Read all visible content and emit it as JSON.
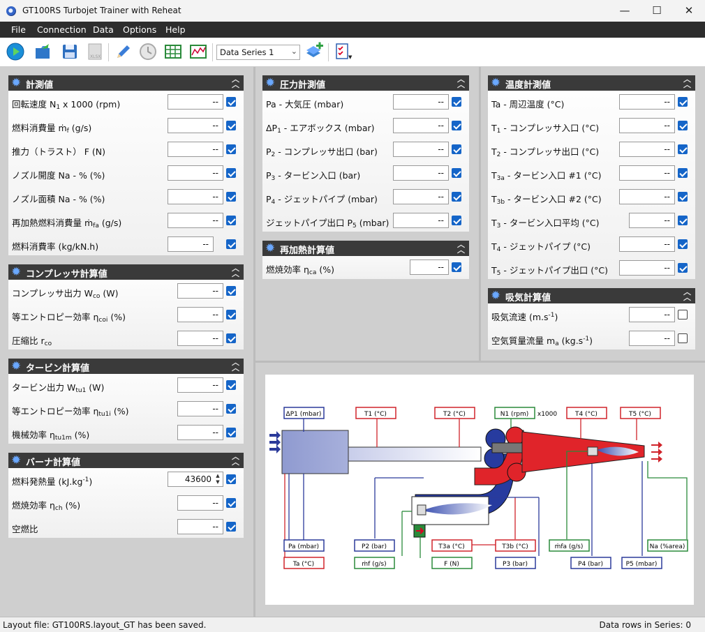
{
  "window": {
    "title": "GT100RS Turbojet Trainer with Reheat",
    "minimize": "—",
    "maximize": "☐",
    "close": "✕"
  },
  "menu": [
    "File",
    "Connection",
    "Data",
    "Options",
    "Help"
  ],
  "toolbar": {
    "series_select": "Data Series 1",
    "icons": [
      "run-icon",
      "open-folder-icon",
      "save-icon",
      "export-xlsx-icon",
      "pencil-icon",
      "clock-icon",
      "table-icon",
      "chart-icon",
      "add-series-icon",
      "checklist-icon"
    ]
  },
  "panels": {
    "measured": {
      "title": "計測値",
      "rows": [
        {
          "label": "回転速度 N",
          "sub": "1",
          "tail": " x 1000  (rpm)",
          "value": "--",
          "checked": true
        },
        {
          "label": "燃料消費量 ṁ",
          "sub": "f",
          "tail": "  (g/s)",
          "value": "--",
          "checked": true
        },
        {
          "label": "推力（トラスト） F  (N)",
          "sub": "",
          "tail": "",
          "value": "--",
          "checked": true
        },
        {
          "label": "ノズル開度 Na - %  (%)",
          "sub": "",
          "tail": "",
          "value": "--",
          "checked": true
        },
        {
          "label": "ノズル面積 Na - %  (%)",
          "sub": "",
          "tail": "",
          "value": "--",
          "checked": true
        },
        {
          "label": "再加熱燃料消費量 ṁ",
          "sub": "fa",
          "tail": "  (g/s)",
          "value": "--",
          "checked": true
        },
        {
          "label": "燃料消費率  (kg/kN.h)",
          "sub": "",
          "tail": "",
          "value": "--",
          "checked": true
        }
      ]
    },
    "compressor": {
      "title": "コンプレッサ計算値",
      "rows": [
        {
          "label": "コンプレッサ出力 W",
          "sub": "co",
          "tail": "  (W)",
          "value": "--",
          "checked": true
        },
        {
          "label": "等エントロピー効率 η",
          "sub": "coi",
          "tail": "  (%)",
          "value": "--",
          "checked": true
        },
        {
          "label": "圧縮比 r",
          "sub": "co",
          "tail": "",
          "value": "--",
          "checked": true
        }
      ]
    },
    "turbine": {
      "title": "タービン計算値",
      "rows": [
        {
          "label": "タービン出力 W",
          "sub": "tu1",
          "tail": "  (W)",
          "value": "--",
          "checked": true
        },
        {
          "label": "等エントロピー効率 η",
          "sub": "tu1i",
          "tail": "  (%)",
          "value": "--",
          "checked": true
        },
        {
          "label": "機械効率 η",
          "sub": "tu1m",
          "tail": "  (%)",
          "value": "--",
          "checked": true
        }
      ]
    },
    "burner": {
      "title": "バーナ計算値",
      "rows": [
        {
          "label": "燃料発熱量  (kJ.kg",
          "sub": "",
          "tail": "",
          "sup": "-1",
          "tail2": ")",
          "value": "43600",
          "checked": true,
          "spin": true
        },
        {
          "label": "燃焼効率 η",
          "sub": "ch",
          "tail": "  (%)",
          "value": "--",
          "checked": true
        },
        {
          "label": "空燃比",
          "sub": "",
          "tail": "",
          "value": "--",
          "checked": true
        }
      ]
    },
    "pressure": {
      "title": "圧力計測値",
      "rows": [
        {
          "label": "Pa - 大気圧  (mbar)",
          "sub": "",
          "tail": "",
          "value": "--",
          "checked": true
        },
        {
          "label": "ΔP",
          "sub": "1",
          "tail": " - エアボックス  (mbar)",
          "value": "--",
          "checked": true
        },
        {
          "label": "P",
          "sub": "2",
          "tail": " - コンプレッサ出口  (bar)",
          "value": "--",
          "checked": true
        },
        {
          "label": "P",
          "sub": "3",
          "tail": " - タービン入口  (bar)",
          "value": "--",
          "checked": true
        },
        {
          "label": "P",
          "sub": "4",
          "tail": " - ジェットパイプ  (mbar)",
          "value": "--",
          "checked": true
        },
        {
          "label": "ジェットパイプ出口 P",
          "sub": "5",
          "tail": "  (mbar)",
          "value": "--",
          "checked": true
        }
      ]
    },
    "reheat": {
      "title": "再加熱計算値",
      "rows": [
        {
          "label": "燃焼効率 η",
          "sub": "ca",
          "tail": "  (%)",
          "value": "--",
          "checked": true
        }
      ]
    },
    "temperature": {
      "title": "温度計測値",
      "rows": [
        {
          "label": "Ta - 周辺温度  (°C)",
          "sub": "",
          "tail": "",
          "value": "--",
          "checked": true
        },
        {
          "label": "T",
          "sub": "1",
          "tail": " - コンプレッサ入口  (°C)",
          "value": "--",
          "checked": true
        },
        {
          "label": "T",
          "sub": "2",
          "tail": " - コンプレッサ出口  (°C)",
          "value": "--",
          "checked": true
        },
        {
          "label": "T",
          "sub": "3a",
          "tail": " - タービン入口 #1  (°C)",
          "value": "--",
          "checked": true
        },
        {
          "label": "T",
          "sub": "3b",
          "tail": " - タービン入口 #2  (°C)",
          "value": "--",
          "checked": true
        },
        {
          "label": "T",
          "sub": "3",
          "tail": " - タービン入口平均  (°C)",
          "value": "--",
          "checked": true
        },
        {
          "label": "T",
          "sub": "4",
          "tail": " - ジェットパイプ  (°C)",
          "value": "--",
          "checked": true
        },
        {
          "label": "T",
          "sub": "5",
          "tail": " - ジェットパイプ出口  (°C)",
          "value": "--",
          "checked": true
        }
      ]
    },
    "intake": {
      "title": "吸気計算値",
      "rows": [
        {
          "label": "吸気流速  (m.s",
          "sub": "",
          "tail": "",
          "sup": "-1",
          "tail2": ")",
          "value": "--",
          "checked": false
        },
        {
          "label": "空気質量流量 m",
          "sub": "a",
          "tail": "  (kg.s",
          "sup": "-1",
          "tail2": ")",
          "value": "--",
          "checked": false
        }
      ]
    }
  },
  "diagram": {
    "labels": {
      "dp1": "ΔP1 (mbar)",
      "t1": "T1 (°C)",
      "t2": "T2 (°C)",
      "n1": "N1 (rpm)",
      "x1000": "x1000",
      "t4": "T4 (°C)",
      "t5": "T5 (°C)",
      "pa": "Pa (mbar)",
      "ta": "Ta (°C)",
      "p2": "P2 (bar)",
      "mf": "ṁf (g/s)",
      "t3a": "T3a (°C)",
      "t3b": "T3b (°C)",
      "f": "F (N)",
      "p3": "P3 (bar)",
      "mfa": "ṁfa (g/s)",
      "p4": "P4 (bar)",
      "p5": "P5 (mbar)",
      "na": "Na (%area)"
    }
  },
  "status": {
    "left": "Layout file: GT100RS.layout_GT has been saved.",
    "right": "Data rows in Series: 0"
  }
}
